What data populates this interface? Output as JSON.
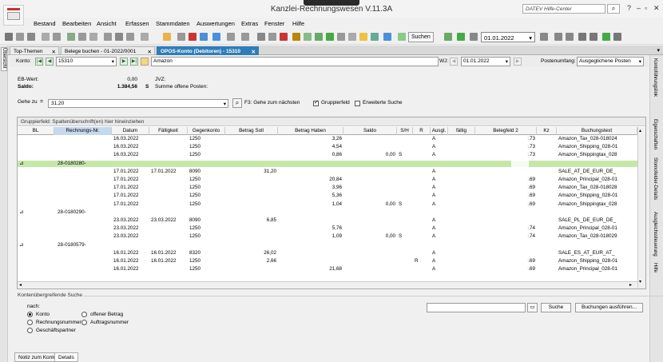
{
  "app": {
    "title": "Kanzlei-Rechnungswesen V.11.3A",
    "help_search_placeholder": "DATEV Hilfe-Center"
  },
  "menu": [
    "Bestand",
    "Bearbeiten",
    "Ansicht",
    "Erfassen",
    "Stammdaten",
    "Auswertungen",
    "Extras",
    "Fenster",
    "Hilfe"
  ],
  "toolbar": {
    "search_label": "Suchen",
    "date": "01.01.2022"
  },
  "tabs": [
    {
      "label": "Top-Themen",
      "active": false
    },
    {
      "label": "Belege buchen - 01-2022/0001",
      "active": false
    },
    {
      "label": "OPOS-Konto (Debitoren) - 15310",
      "active": true
    }
  ],
  "left_sidebar": {
    "label": "Übersicht"
  },
  "konto": {
    "label": "Konto:",
    "number": "15310",
    "name": "Amazon",
    "wj_label": "WJ:",
    "wj_date": "01.01.2022",
    "postenumfang_label": "Postenumfang:",
    "postenumfang_value": "Ausgeglichene Posten"
  },
  "summary": {
    "eb_label": "EB-Wert:",
    "eb_value": "0,00",
    "saldo_label": "Saldo:",
    "saldo_value": "1.384,56",
    "saldo_side": "S",
    "jvz_label": "JVZ:",
    "summe_label": "Summe offene Posten:"
  },
  "gehe": {
    "label": "Gehe zu",
    "value": "31,20",
    "f3_label": "F3: Gehe zum nächsten",
    "gruppierfeld_label": "Gruppierfeld",
    "gruppierfeld_checked": true,
    "erweiterte_label": "Erweiterte Suche",
    "erweiterte_checked": false
  },
  "grid": {
    "group_hint": "Gruppierfeld: Spaltenüberschrift(en) hier hineinziehen",
    "columns": [
      "BL",
      "Rechnungs-Nr.",
      "Datum",
      "Fälligkeit",
      "Gegenkonto",
      "Betrag Soll",
      "Betrag Haben",
      "Saldo",
      "S/H",
      "R",
      "Ausgl.",
      "fällig",
      "Belegfeld 2",
      "Kz",
      "Buchungstext"
    ],
    "rows": [
      {
        "type": "sub",
        "rn": "",
        "datum": "16.03.2022",
        "faell": "",
        "gk": "1250",
        "soll": "",
        "haben": "3,26",
        "saldo": "",
        "sh": "",
        "r": "",
        "ausgl": "A",
        "beleg": "173",
        "text": "Amazon_Tax_028-018024"
      },
      {
        "type": "sub",
        "rn": "",
        "datum": "16.03.2022",
        "faell": "",
        "gk": "1250",
        "soll": "",
        "haben": "4,54",
        "saldo": "",
        "sh": "",
        "r": "",
        "ausgl": "A",
        "beleg": "173",
        "text": "Amazon_Shipping_028-01"
      },
      {
        "type": "sub",
        "rn": "",
        "datum": "16.03.2022",
        "faell": "",
        "gk": "1250",
        "soll": "",
        "haben": "0,86",
        "saldo": "0,00",
        "sh": "S",
        "r": "",
        "ausgl": "A",
        "beleg": "173",
        "text": "Amazon_Shippingtax_028"
      },
      {
        "type": "group",
        "rn": "28-0180280-"
      },
      {
        "type": "sub",
        "rn": "",
        "datum": "17.01.2022",
        "faell": "17.01.2022",
        "gk": "8090",
        "soll": "31,20",
        "haben": "",
        "saldo": "",
        "sh": "",
        "r": "",
        "ausgl": "A",
        "beleg": "",
        "text": "SALE_AT_DE_EUR_DE_"
      },
      {
        "type": "sub",
        "rn": "",
        "datum": "17.01.2022",
        "faell": "",
        "gk": "1250",
        "soll": "",
        "haben": "20,84",
        "saldo": "",
        "sh": "",
        "r": "",
        "ausgl": "A",
        "beleg": "169",
        "text": "Amazon_Principal_028-01"
      },
      {
        "type": "sub",
        "rn": "",
        "datum": "17.01.2022",
        "faell": "",
        "gk": "1250",
        "soll": "",
        "haben": "3,96",
        "saldo": "",
        "sh": "",
        "r": "",
        "ausgl": "A",
        "beleg": "169",
        "text": "Amazon_Tax_028-018028"
      },
      {
        "type": "sub",
        "rn": "",
        "datum": "17.01.2022",
        "faell": "",
        "gk": "1250",
        "soll": "",
        "haben": "5,36",
        "saldo": "",
        "sh": "",
        "r": "",
        "ausgl": "A",
        "beleg": "169",
        "text": "Amazon_Shipping_028-01"
      },
      {
        "type": "sub",
        "rn": "",
        "datum": "17.01.2022",
        "faell": "",
        "gk": "1250",
        "soll": "",
        "haben": "1,04",
        "saldo": "0,00",
        "sh": "S",
        "r": "",
        "ausgl": "A",
        "beleg": "169",
        "text": "Amazon_Shippingtax_028"
      },
      {
        "type": "groupplain",
        "rn": "28-0180290-"
      },
      {
        "type": "sub",
        "rn": "",
        "datum": "23.03.2022",
        "faell": "23.03.2022",
        "gk": "8090",
        "soll": "6,85",
        "haben": "",
        "saldo": "",
        "sh": "",
        "r": "",
        "ausgl": "A",
        "beleg": "",
        "text": "SALE_PL_DE_EUR_DE_"
      },
      {
        "type": "sub",
        "rn": "",
        "datum": "23.03.2022",
        "faell": "",
        "gk": "1250",
        "soll": "",
        "haben": "5,76",
        "saldo": "",
        "sh": "",
        "r": "",
        "ausgl": "A",
        "beleg": "174",
        "text": "Amazon_Principal_028-01"
      },
      {
        "type": "sub",
        "rn": "",
        "datum": "23.03.2022",
        "faell": "",
        "gk": "1250",
        "soll": "",
        "haben": "1,09",
        "saldo": "0,00",
        "sh": "S",
        "r": "",
        "ausgl": "A",
        "beleg": "174",
        "text": "Amazon_Tax_028-018029"
      },
      {
        "type": "groupplain",
        "rn": "28-0180579-"
      },
      {
        "type": "sub",
        "rn": "",
        "datum": "16.01.2022",
        "faell": "16.01.2022",
        "gk": "8320",
        "soll": "26,02",
        "haben": "",
        "saldo": "",
        "sh": "",
        "r": "",
        "ausgl": "A",
        "beleg": "",
        "text": "SALE_ES_AT_EUR_AT_"
      },
      {
        "type": "sub",
        "rn": "",
        "datum": "16.01.2022",
        "faell": "16.01.2022",
        "gk": "1250",
        "soll": "2,66",
        "haben": "",
        "saldo": "",
        "sh": "",
        "r": "R",
        "ausgl": "A",
        "beleg": "169",
        "text": "Amazon_Shipping_028-01"
      },
      {
        "type": "sub",
        "rn": "",
        "datum": "16.01.2022",
        "faell": "",
        "gk": "1250",
        "soll": "",
        "haben": "21,68",
        "saldo": "",
        "sh": "",
        "r": "",
        "ausgl": "A",
        "beleg": "169",
        "text": "Amazon_Principal_028-01"
      }
    ]
  },
  "search_panel": {
    "title": "Kontenübergreifende Suche",
    "nach_label": "nach:",
    "opt_konto": "Konto",
    "opt_rechnungsnummer": "Rechnungsnummer",
    "opt_geschaeftspartner": "Geschäftspartner",
    "opt_offener_betrag": "offener Betrag",
    "opt_auftragsnummer": "Auftragsnummer",
    "selected": "Konto",
    "suche_button": "Suche",
    "buchungen_button": "Buchungen ausführen..."
  },
  "bottom_tabs": [
    {
      "label": "Notiz zum Konto",
      "active": false
    },
    {
      "label": "Details",
      "active": true
    }
  ],
  "right_sidebar": [
    "Kontoführungslink",
    "Eigenschaften",
    "Stornofelder-Details",
    "Ausgleichssteuerung",
    "Hilfe"
  ]
}
